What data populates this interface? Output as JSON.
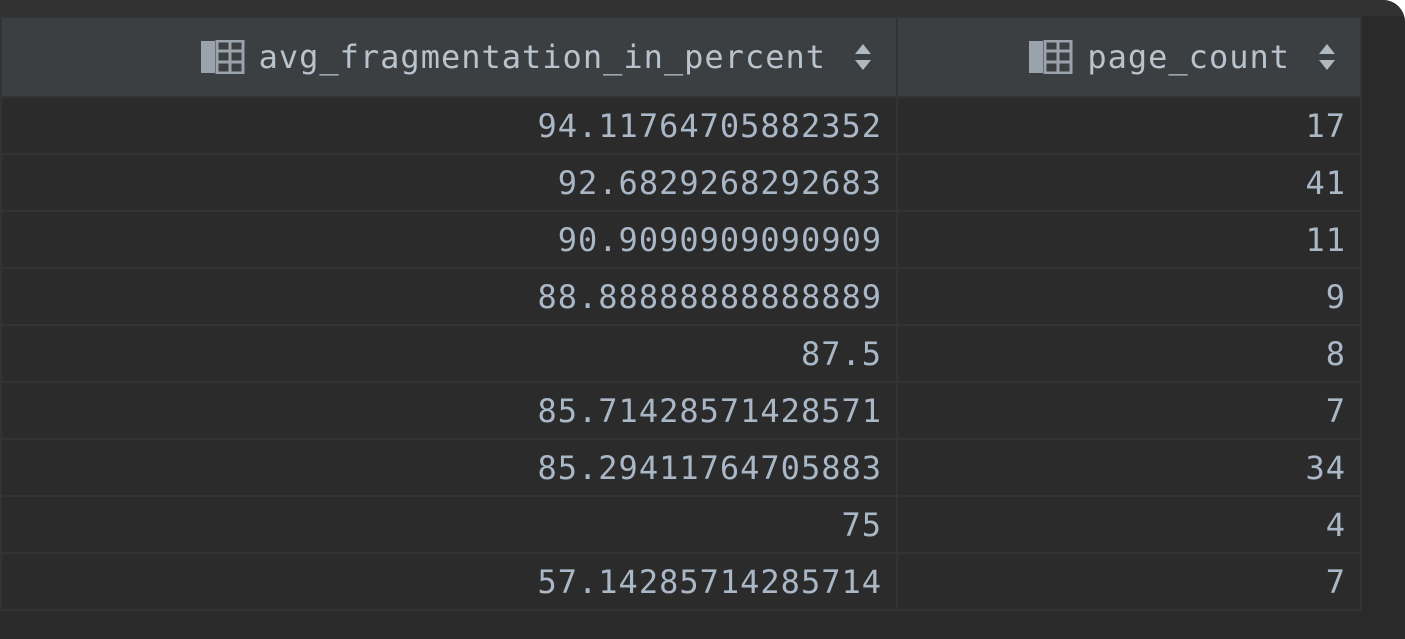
{
  "columns": [
    {
      "label": "avg_fragmentation_in_percent"
    },
    {
      "label": "page_count"
    }
  ],
  "icons": {
    "column_type": "table-column-icon",
    "sort": "sort-arrows-icon"
  },
  "colors": {
    "background": "#2b2b2b",
    "header_background": "#3c3f41",
    "text": "#a9b7c6",
    "grid_line": "#333333"
  },
  "rows": [
    {
      "avg_fragmentation_in_percent": "94.11764705882352",
      "page_count": "17"
    },
    {
      "avg_fragmentation_in_percent": "92.6829268292683",
      "page_count": "41"
    },
    {
      "avg_fragmentation_in_percent": "90.9090909090909",
      "page_count": "11"
    },
    {
      "avg_fragmentation_in_percent": "88.88888888888889",
      "page_count": "9"
    },
    {
      "avg_fragmentation_in_percent": "87.5",
      "page_count": "8"
    },
    {
      "avg_fragmentation_in_percent": "85.71428571428571",
      "page_count": "7"
    },
    {
      "avg_fragmentation_in_percent": "85.29411764705883",
      "page_count": "34"
    },
    {
      "avg_fragmentation_in_percent": "75",
      "page_count": "4"
    },
    {
      "avg_fragmentation_in_percent": "57.14285714285714",
      "page_count": "7"
    }
  ]
}
